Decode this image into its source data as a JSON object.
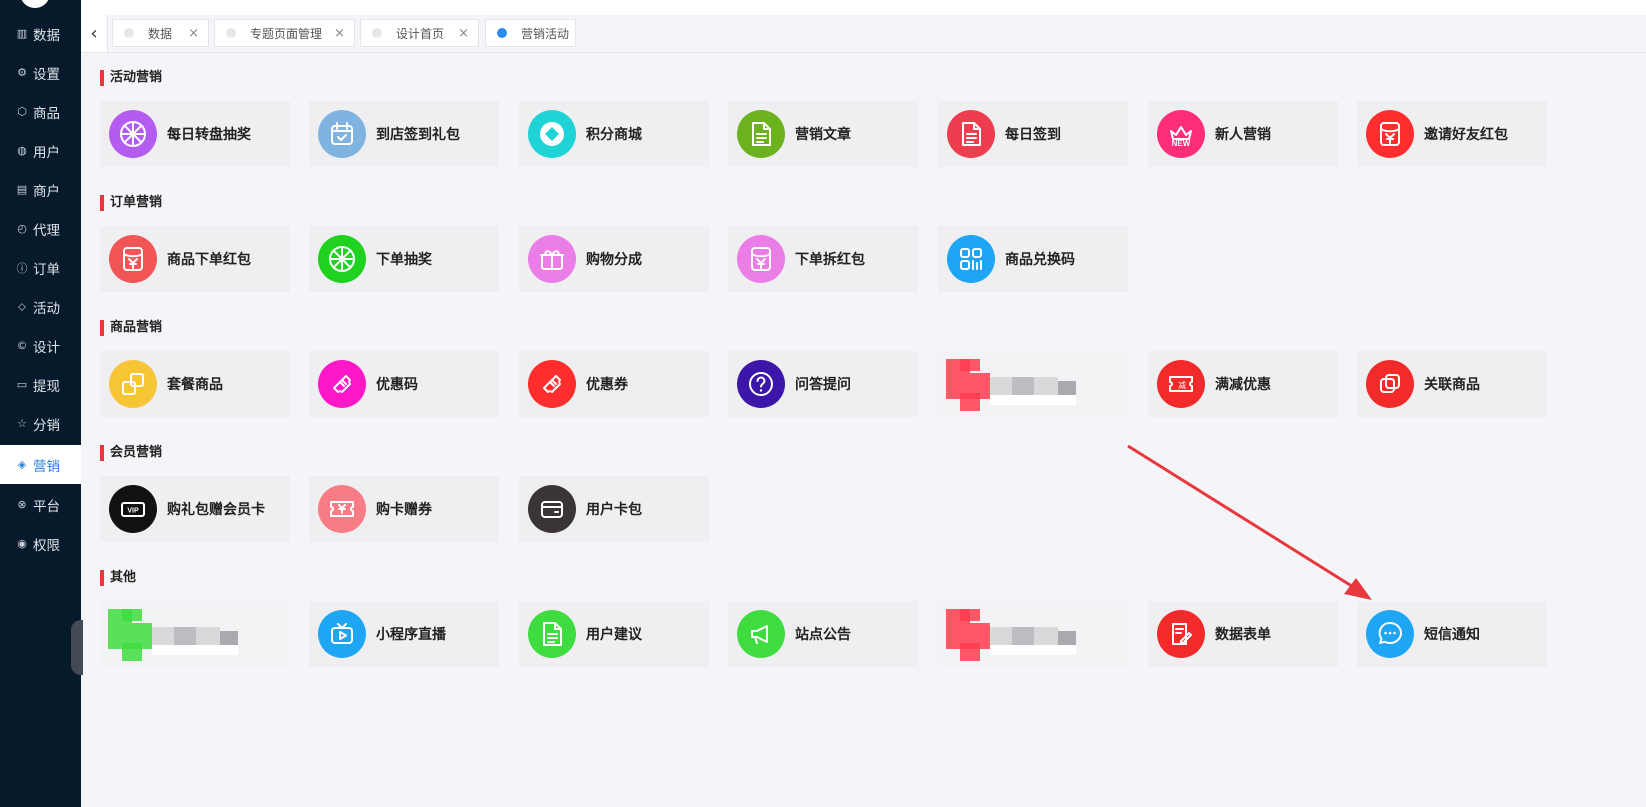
{
  "sidebar": {
    "items": [
      {
        "label": "数据",
        "icon": "chart-icon"
      },
      {
        "label": "设置",
        "icon": "gear-icon"
      },
      {
        "label": "商品",
        "icon": "box-icon"
      },
      {
        "label": "用户",
        "icon": "user-icon"
      },
      {
        "label": "商户",
        "icon": "list-icon"
      },
      {
        "label": "代理",
        "icon": "clock-icon"
      },
      {
        "label": "订单",
        "icon": "info-icon"
      },
      {
        "label": "活动",
        "icon": "tag-icon"
      },
      {
        "label": "设计",
        "icon": "copyright-icon"
      },
      {
        "label": "提现",
        "icon": "card-icon"
      },
      {
        "label": "分销",
        "icon": "star-icon"
      },
      {
        "label": "营销",
        "icon": "cube-icon",
        "active": true
      },
      {
        "label": "平台",
        "icon": "xbox-icon"
      },
      {
        "label": "权限",
        "icon": "compass-icon"
      }
    ]
  },
  "tabs": [
    {
      "label": "数据",
      "active": false,
      "closable": true
    },
    {
      "label": "专题页面管理",
      "active": false,
      "closable": true
    },
    {
      "label": "设计首页",
      "active": false,
      "closable": true
    },
    {
      "label": "营销活动",
      "active": true,
      "closable": false
    }
  ],
  "tab_close_glyph": "×",
  "back_glyph": "‹",
  "sections": [
    {
      "title": "活动营销",
      "items": [
        {
          "label": "每日转盘抽奖",
          "icon": "wheel-icon",
          "color": "#b45cf0"
        },
        {
          "label": "到店签到礼包",
          "icon": "calendar-check-icon",
          "color": "#7fb3e0"
        },
        {
          "label": "积分商城",
          "icon": "diamond-icon",
          "color": "#1fd3d6"
        },
        {
          "label": "营销文章",
          "icon": "document-icon",
          "color": "#6bb21e"
        },
        {
          "label": "每日签到",
          "icon": "document-icon",
          "color": "#ee3d4f"
        },
        {
          "label": "新人营销",
          "icon": "new-crown-icon",
          "color": "#ff2d7a"
        },
        {
          "label": "邀请好友红包",
          "icon": "red-envelope-icon",
          "color": "#ff2d2d"
        }
      ]
    },
    {
      "title": "订单营销",
      "items": [
        {
          "label": "商品下单红包",
          "icon": "red-envelope-icon",
          "color": "#f25555"
        },
        {
          "label": "下单抽奖",
          "icon": "wheel-icon",
          "color": "#1fd21f"
        },
        {
          "label": "购物分成",
          "icon": "gift-icon",
          "color": "#ea7ee6"
        },
        {
          "label": "下单拆红包",
          "icon": "red-envelope-icon",
          "color": "#ea7ee6"
        },
        {
          "label": "商品兑换码",
          "icon": "qrcode-icon",
          "color": "#1ea6f5"
        }
      ]
    },
    {
      "title": "商品营销",
      "items": [
        {
          "label": "套餐商品",
          "icon": "package-icon",
          "color": "#f8c537"
        },
        {
          "label": "优惠码",
          "icon": "ticket-icon",
          "color": "#ff17c8"
        },
        {
          "label": "优惠券",
          "icon": "ticket-icon",
          "color": "#ff2d2d"
        },
        {
          "label": "问答提问",
          "icon": "question-icon",
          "color": "#3b16a8"
        },
        {
          "label": "",
          "icon": "pixelated-icon",
          "color": "#ff3b4f",
          "pixelated": true
        },
        {
          "label": "满减优惠",
          "icon": "discount-coupon-icon",
          "color": "#f22a2a"
        },
        {
          "label": "关联商品",
          "icon": "link-box-icon",
          "color": "#f22a2a"
        }
      ]
    },
    {
      "title": "会员营销",
      "items": [
        {
          "label": "购礼包赠会员卡",
          "icon": "vip-card-icon",
          "color": "#111111"
        },
        {
          "label": "购卡赠券",
          "icon": "coupon-icon",
          "color": "#f87c86"
        },
        {
          "label": "用户卡包",
          "icon": "wallet-icon",
          "color": "#3a3434"
        }
      ]
    },
    {
      "title": "其他",
      "items": [
        {
          "label": "",
          "icon": "pixelated-icon",
          "color": "#3fdc3f",
          "pixelated": true
        },
        {
          "label": "小程序直播",
          "icon": "tv-icon",
          "color": "#1ea6f5"
        },
        {
          "label": "用户建议",
          "icon": "document-icon",
          "color": "#3fdc3f"
        },
        {
          "label": "站点公告",
          "icon": "megaphone-icon",
          "color": "#3fdc3f"
        },
        {
          "label": "",
          "icon": "pixelated-icon",
          "color": "#ff3b4f",
          "pixelated": true
        },
        {
          "label": "数据表单",
          "icon": "form-edit-icon",
          "color": "#f22a2a"
        },
        {
          "label": "短信通知",
          "icon": "chat-bubble-icon",
          "color": "#1ea6f5"
        }
      ]
    }
  ],
  "annotation": {
    "type": "red-arrow",
    "color": "#e8383d",
    "points_to": "短信通知"
  }
}
